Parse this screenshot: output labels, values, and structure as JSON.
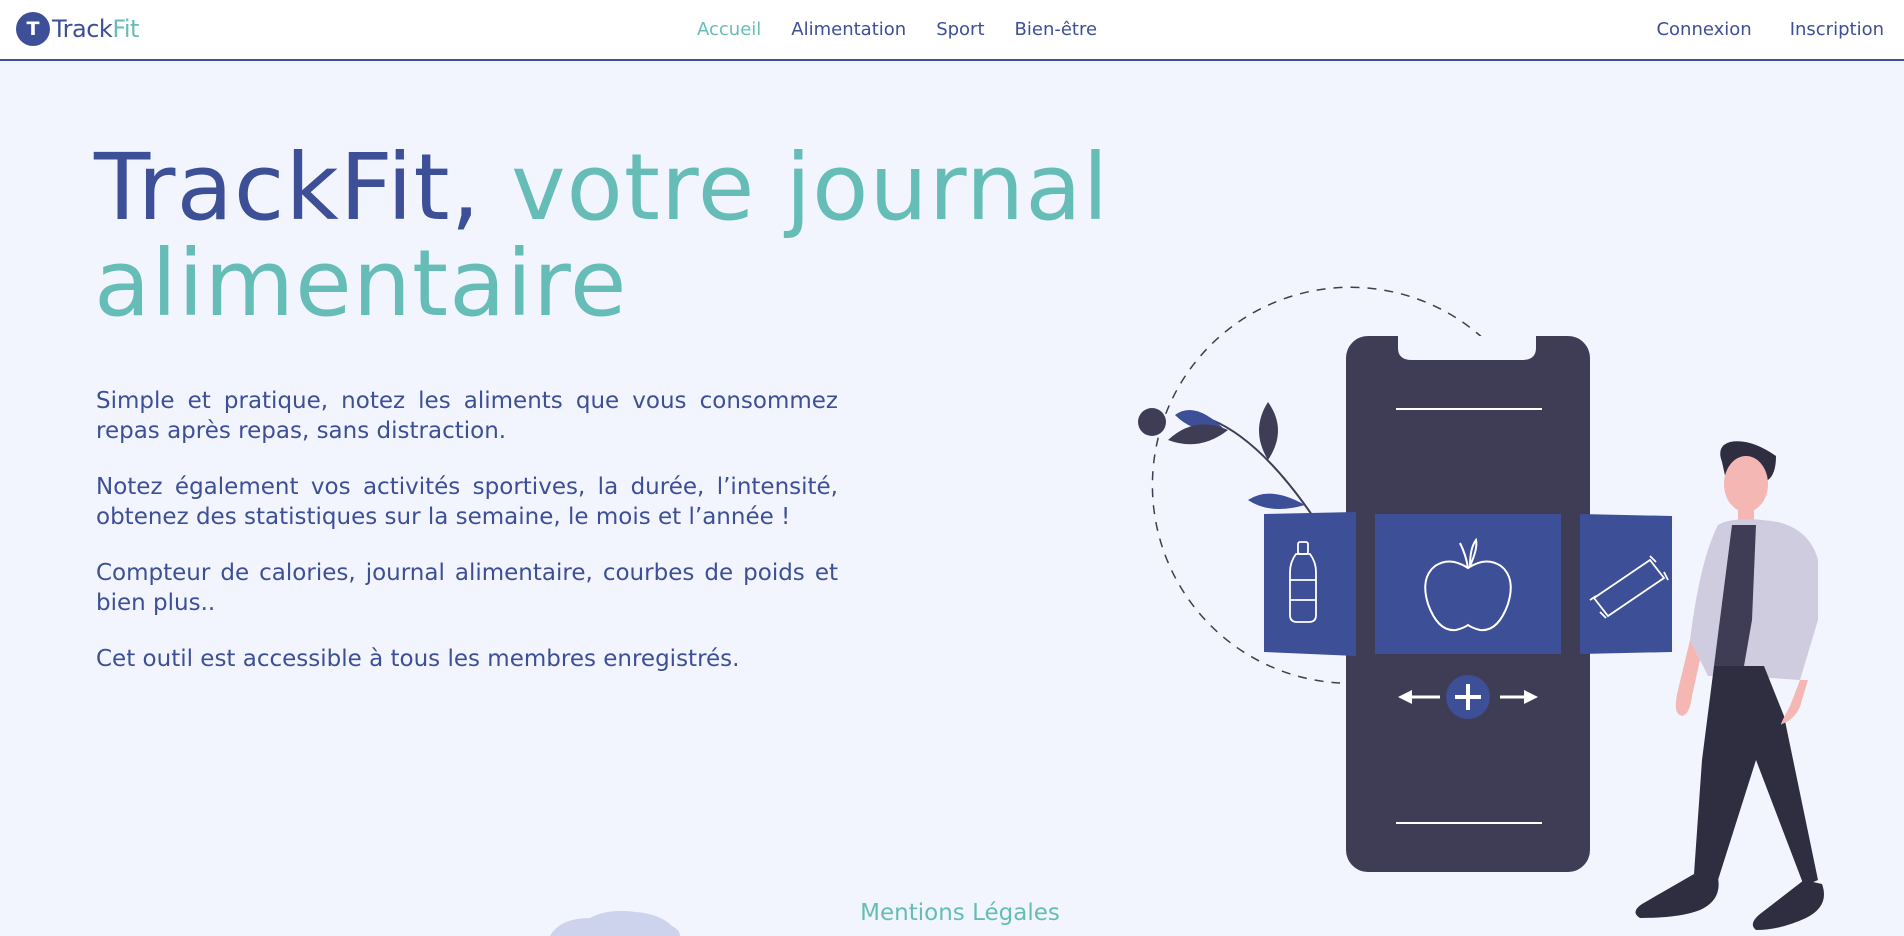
{
  "header": {
    "logo": {
      "icon_letter": "T",
      "brand_part1": "Track",
      "brand_part2": "Fit"
    },
    "nav": [
      {
        "label": "Accueil",
        "active": true
      },
      {
        "label": "Alimentation",
        "active": false
      },
      {
        "label": "Sport",
        "active": false
      },
      {
        "label": "Bien-être",
        "active": false
      }
    ],
    "auth": {
      "login": "Connexion",
      "register": "Inscription"
    }
  },
  "hero": {
    "title_brand": "TrackFit,",
    "title_rest": "votre journal alimentaire",
    "paragraphs": [
      "Simple et pratique, notez les aliments que vous consommez repas après repas, sans distraction.",
      "Notez également vos activités sportives, la durée, l’intensité, obtenez des statistiques sur la semaine, le mois et l’année !",
      "Compteur de calories, journal alimentaire, courbes de poids et bien plus..",
      "Cet outil est accessible à tous les membres enregistrés."
    ]
  },
  "footer": {
    "legal_link": "Mentions Légales"
  },
  "colors": {
    "primary": "#3d4f96",
    "accent": "#66bdb8",
    "background": "#f2f5fd",
    "phone": "#3f3d56"
  },
  "icons": [
    "logo-icon",
    "water-bottle-icon",
    "apple-icon",
    "snack-bar-icon",
    "add-icon",
    "arrow-left-icon",
    "arrow-right-icon"
  ]
}
